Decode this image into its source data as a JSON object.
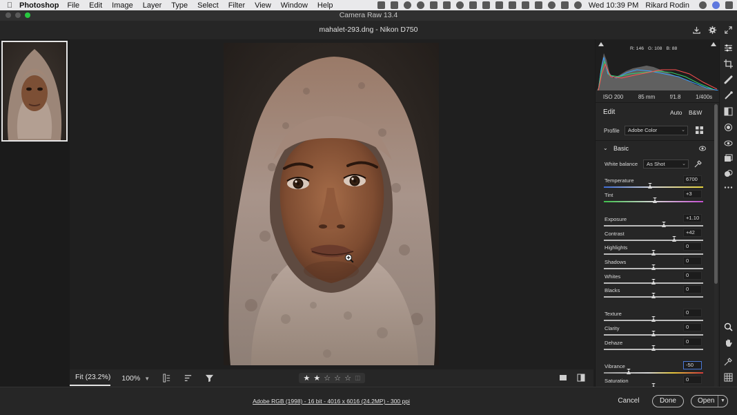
{
  "menubar": {
    "app": "Photoshop",
    "items": [
      "File",
      "Edit",
      "Image",
      "Layer",
      "Type",
      "Select",
      "Filter",
      "View",
      "Window",
      "Help"
    ],
    "clock": "Wed 10:39 PM",
    "user": "Rikard Rodin"
  },
  "window": {
    "title": "Camera Raw 13.4"
  },
  "header": {
    "file_label": "mahalet-293.dng  -  Nikon D750"
  },
  "histogram": {
    "r": "R: 146",
    "g": "G: 108",
    "b": "B: 88"
  },
  "exif": {
    "iso": "ISO 200",
    "focal": "85 mm",
    "aperture": "f/1.8",
    "shutter": "1/400s"
  },
  "edit": {
    "title": "Edit",
    "auto": "Auto",
    "bw": "B&W"
  },
  "profile": {
    "label": "Profile",
    "value": "Adobe Color"
  },
  "basic": {
    "title": "Basic",
    "white_balance_label": "White balance",
    "white_balance_value": "As Shot",
    "sliders": [
      {
        "label": "Temperature",
        "value": "6700",
        "level": 0.47
      },
      {
        "label": "Tint",
        "value": "+3",
        "level": 0.52
      },
      {
        "label": "Exposure",
        "value": "+1.10",
        "level": 0.61
      },
      {
        "label": "Contrast",
        "value": "+42",
        "level": 0.71
      },
      {
        "label": "Highlights",
        "value": "0",
        "level": 0.5
      },
      {
        "label": "Shadows",
        "value": "0",
        "level": 0.5
      },
      {
        "label": "Whites",
        "value": "0",
        "level": 0.5
      },
      {
        "label": "Blacks",
        "value": "0",
        "level": 0.5
      },
      {
        "label": "Texture",
        "value": "0",
        "level": 0.5
      },
      {
        "label": "Clarity",
        "value": "0",
        "level": 0.5
      },
      {
        "label": "Dehaze",
        "value": "0",
        "level": 0.5
      },
      {
        "label": "Vibrance",
        "value": "-50",
        "level": 0.25
      },
      {
        "label": "Saturation",
        "value": "0",
        "level": 0.5
      }
    ]
  },
  "canvas_bar": {
    "fit": "Fit (23.2%)",
    "zoom": "100%"
  },
  "footer": {
    "info": "Adobe RGB (1998) - 16 bit - 4016 x 6016 (24.2MP) - 300 ppi",
    "cancel": "Cancel",
    "done": "Done",
    "open": "Open"
  },
  "colors": {
    "accent_blue": "#4a78d6",
    "panel_bg": "#262626",
    "canvas_bg": "#1f1f1f"
  }
}
